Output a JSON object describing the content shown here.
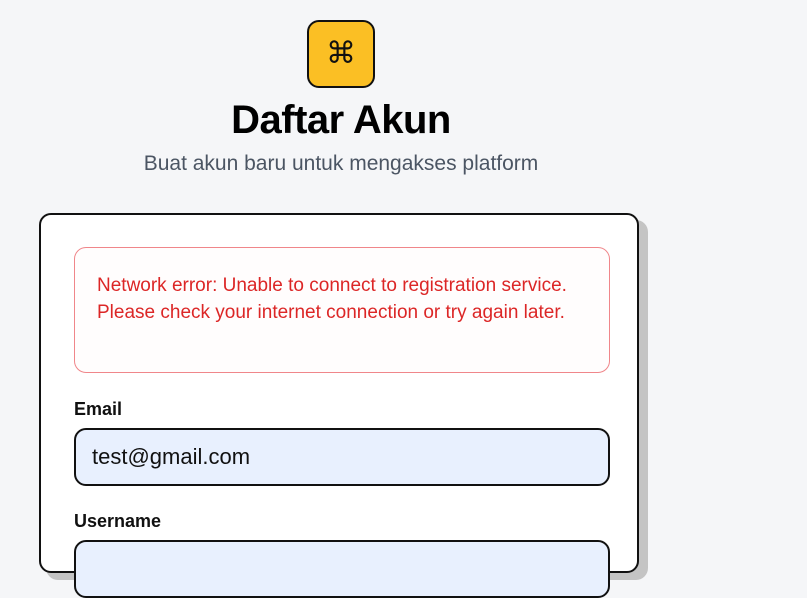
{
  "header": {
    "logo_icon": "command-icon",
    "logo_glyph": "⌘",
    "title": "Daftar Akun",
    "subtitle": "Buat akun baru untuk mengakses platform"
  },
  "form": {
    "error_message": "Network error: Unable to connect to registration service. Please check your internet connection or try again later.",
    "email": {
      "label": "Email",
      "value": "test@gmail.com"
    },
    "username": {
      "label": "Username",
      "value": ""
    }
  },
  "colors": {
    "accent": "#fbbf24",
    "error": "#dc2626",
    "input_bg": "#e8f0fe"
  }
}
